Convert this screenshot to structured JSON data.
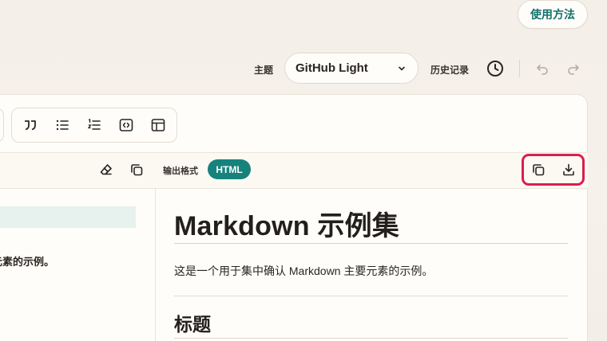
{
  "top": {
    "help_label": "使用方法"
  },
  "header": {
    "theme_label": "主题",
    "theme_value": "GitHub Light",
    "history_label": "历史记录"
  },
  "toolbar": {
    "icons": [
      "quote-icon",
      "bullet-list-icon",
      "numbered-list-icon",
      "code-block-icon",
      "table-icon"
    ]
  },
  "output": {
    "format_label": "输出格式",
    "format_value": "HTML"
  },
  "editor": {
    "visible_line": "元素的示例。"
  },
  "preview": {
    "h1": "Markdown 示例集",
    "paragraph": "这是一个用于集中确认 Markdown 主要元素的示例。",
    "h2": "标题"
  },
  "colors": {
    "accent": "#17827c",
    "highlight": "#d81f4f"
  }
}
